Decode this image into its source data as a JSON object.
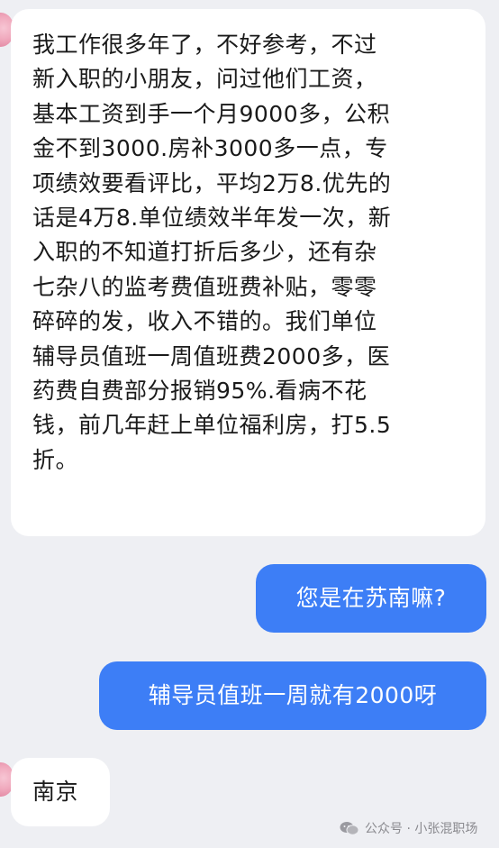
{
  "chat": {
    "messages": [
      {
        "sender": "other",
        "lines": [
          "我工作很多年了，不好参考，不过",
          "新入职的小朋友，问过他们工资，",
          "基本工资到手一个月9000多，公积",
          "金不到3000.房补3000多一点，专",
          "项绩效要看评比，平均2万8.优先的",
          "话是4万8.单位绩效半年发一次，新",
          "入职的不知道打折后多少，还有杂",
          "七杂八的监考费值班费补贴，零零",
          "碎碎的发，收入不错的。我们单位",
          "辅导员值班一周值班费2000多，医",
          "药费自费部分报销95%.看病不花",
          "钱，前几年赶上单位福利房，打5.5",
          "折。"
        ]
      },
      {
        "sender": "me",
        "text": "您是在苏南嘛?"
      },
      {
        "sender": "me",
        "text": "辅导员值班一周就有2000呀"
      },
      {
        "sender": "other",
        "text": "南京"
      }
    ]
  },
  "watermark": {
    "icon": "wechat-icon",
    "text": "公众号 · 小张混职场"
  },
  "colors": {
    "background": "#eeeff3",
    "incoming_bubble": "#ffffff",
    "outgoing_bubble": "#3d7ef6"
  }
}
